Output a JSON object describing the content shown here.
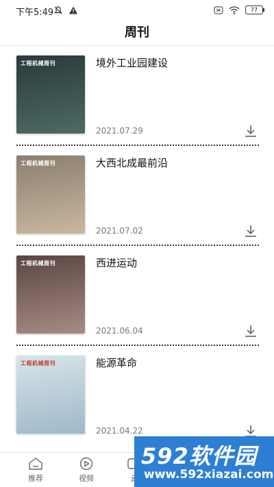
{
  "status_bar": {
    "time": "下午5:49",
    "battery": "77",
    "icons": [
      "mute-icon",
      "warning-icon",
      "sim-icon",
      "wifi-icon",
      "battery-icon"
    ]
  },
  "header": {
    "title": "周刊"
  },
  "colors": {
    "text": "#111111",
    "date": "#777777",
    "divider": "#333333",
    "watermark_bg": "#2d7fd4"
  },
  "issues": [
    {
      "title": "境外工业园建设",
      "date": "2021.07.29",
      "cover_masthead": "工程机械周刊",
      "cover_colors": [
        "#2a3a3c",
        "#4d6a62"
      ]
    },
    {
      "title": "大西北成最前沿",
      "date": "2021.07.02",
      "cover_masthead": "工程机械周刊",
      "cover_colors": [
        "#8c7f6f",
        "#c9b7a0"
      ]
    },
    {
      "title": "西进运动",
      "date": "2021.06.04",
      "cover_masthead": "工程机械周刊",
      "cover_colors": [
        "#5a4542",
        "#a88b85"
      ]
    },
    {
      "title": "能源革命",
      "date": "2021.04.22",
      "cover_masthead": "工程机械周刊",
      "cover_colors": [
        "#d8e4ea",
        "#9fb8c9"
      ]
    }
  ],
  "tabbar": {
    "tabs": [
      {
        "label": "推荐",
        "icon": "home-icon"
      },
      {
        "label": "视频",
        "icon": "play-icon"
      },
      {
        "label": "云",
        "icon": "cloud-icon"
      }
    ]
  },
  "watermark": {
    "brand": "592软件园",
    "url": "www.592xiazai.com"
  }
}
